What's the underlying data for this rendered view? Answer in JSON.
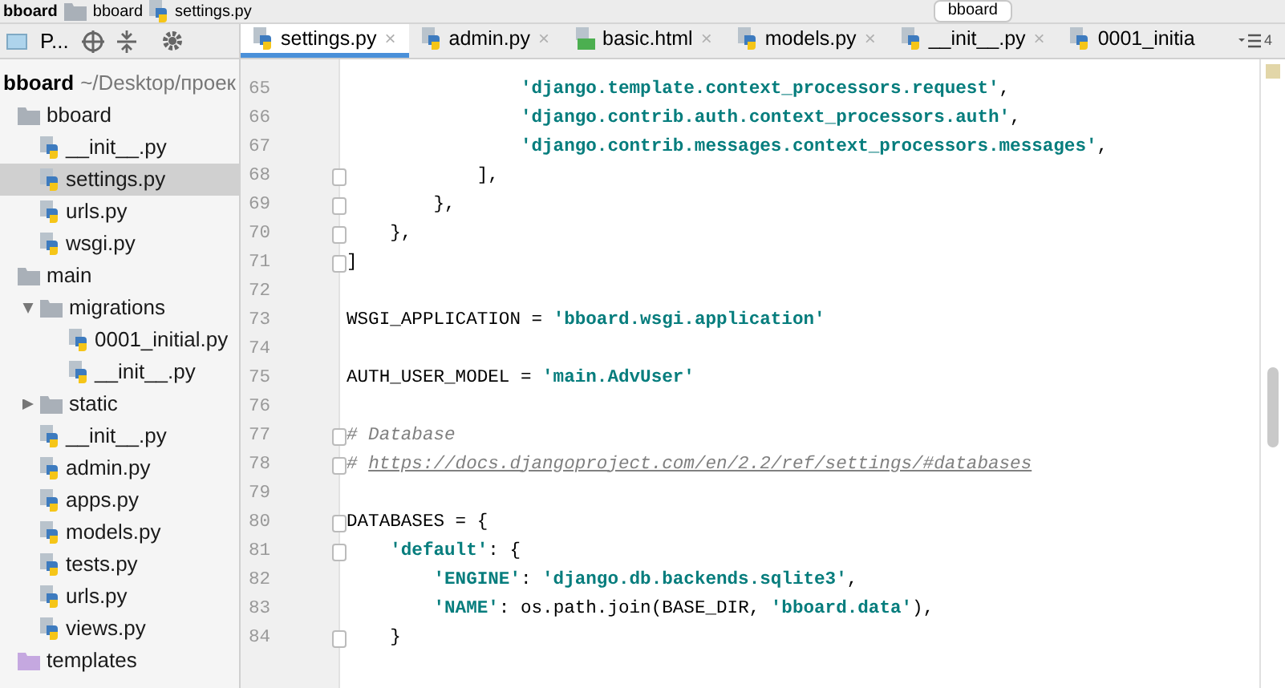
{
  "nav_bar": {
    "crumbs": [
      {
        "label": "bboard",
        "kind": "project"
      },
      {
        "label": "bboard",
        "kind": "folder"
      },
      {
        "label": "settings.py",
        "kind": "python"
      }
    ],
    "run_config": "bboard"
  },
  "project_panel": {
    "selector": "P..."
  },
  "tabs": [
    {
      "label": "settings.py",
      "kind": "python",
      "selected": true,
      "close": "×"
    },
    {
      "label": "admin.py",
      "kind": "python",
      "selected": false,
      "close": "×"
    },
    {
      "label": "basic.html",
      "kind": "html",
      "selected": false,
      "close": "×"
    },
    {
      "label": "models.py",
      "kind": "python",
      "selected": false,
      "close": "×"
    },
    {
      "label": "__init__.py",
      "kind": "python",
      "selected": false,
      "close": "×"
    },
    {
      "label": "0001_initia",
      "kind": "python",
      "selected": false
    }
  ],
  "tabs_overflow": "4",
  "tree": {
    "root": {
      "label": "bboard",
      "path": "~/Desktop/проек"
    },
    "children": [
      {
        "label": "bboard",
        "kind": "folder",
        "children": [
          {
            "label": "__init__.py",
            "kind": "python",
            "selected": false
          },
          {
            "label": "settings.py",
            "kind": "python",
            "selected": true
          },
          {
            "label": "urls.py",
            "kind": "python",
            "selected": false
          },
          {
            "label": "wsgi.py",
            "kind": "python",
            "selected": false
          }
        ]
      },
      {
        "label": "main",
        "kind": "folder",
        "children": [
          {
            "label": "migrations",
            "kind": "folder",
            "expanded": true,
            "children": [
              {
                "label": "0001_initial.py",
                "kind": "python",
                "selected": false
              },
              {
                "label": "__init__.py",
                "kind": "python",
                "selected": false
              }
            ]
          },
          {
            "label": "static",
            "kind": "folder",
            "expanded": false
          },
          {
            "label": "__init__.py",
            "kind": "python",
            "selected": false
          },
          {
            "label": "admin.py",
            "kind": "python",
            "selected": false
          },
          {
            "label": "apps.py",
            "kind": "python",
            "selected": false
          },
          {
            "label": "models.py",
            "kind": "python",
            "selected": false
          },
          {
            "label": "tests.py",
            "kind": "python",
            "selected": false
          },
          {
            "label": "urls.py",
            "kind": "python",
            "selected": false
          },
          {
            "label": "views.py",
            "kind": "python",
            "selected": false
          }
        ]
      },
      {
        "label": "templates",
        "kind": "templates"
      }
    ]
  },
  "editor": {
    "lines": [
      {
        "number": "65",
        "fold": false,
        "tokens": [
          {
            "kind": "string",
            "text": "                'django.template.context_processors.request'"
          },
          {
            "kind": "plain",
            "text": ","
          }
        ]
      },
      {
        "number": "66",
        "fold": false,
        "tokens": [
          {
            "kind": "string",
            "text": "                'django.contrib.auth.context_processors.auth'"
          },
          {
            "kind": "plain",
            "text": ","
          }
        ]
      },
      {
        "number": "67",
        "fold": false,
        "tokens": [
          {
            "kind": "string",
            "text": "                'django.contrib.messages.context_processors.messages'"
          },
          {
            "kind": "plain",
            "text": ","
          }
        ]
      },
      {
        "number": "68",
        "fold": true,
        "tokens": [
          {
            "kind": "plain",
            "text": "            ],"
          }
        ]
      },
      {
        "number": "69",
        "fold": true,
        "tokens": [
          {
            "kind": "plain",
            "text": "        },"
          }
        ]
      },
      {
        "number": "70",
        "fold": true,
        "tokens": [
          {
            "kind": "plain",
            "text": "    },"
          }
        ]
      },
      {
        "number": "71",
        "fold": true,
        "tokens": [
          {
            "kind": "plain",
            "text": "]"
          }
        ]
      },
      {
        "number": "72",
        "fold": false
      },
      {
        "number": "73",
        "fold": false,
        "tokens": [
          {
            "kind": "plain",
            "text": "WSGI_APPLICATION = "
          },
          {
            "kind": "string",
            "text": "'bboard.wsgi.application'"
          }
        ]
      },
      {
        "number": "74",
        "fold": false
      },
      {
        "number": "75",
        "fold": false,
        "tokens": [
          {
            "kind": "plain",
            "text": "AUTH_USER_MODEL = "
          },
          {
            "kind": "string",
            "text": "'main.AdvUser'"
          }
        ]
      },
      {
        "number": "76",
        "fold": false
      },
      {
        "number": "77",
        "fold": true,
        "tokens": [
          {
            "kind": "comment",
            "text": "# Database"
          }
        ]
      },
      {
        "number": "78",
        "fold": true,
        "tokens": [
          {
            "kind": "comment",
            "text": "# "
          },
          {
            "kind": "link",
            "text": "https://docs.djangoproject.com/en/2.2/ref/settings/#databases"
          }
        ]
      },
      {
        "number": "79",
        "fold": false
      },
      {
        "number": "80",
        "fold": true,
        "tokens": [
          {
            "kind": "plain",
            "text": "DATABASES = {"
          }
        ]
      },
      {
        "number": "81",
        "fold": true,
        "tokens": [
          {
            "kind": "string",
            "text": "    'default'"
          },
          {
            "kind": "plain",
            "text": ": {"
          }
        ]
      },
      {
        "number": "82",
        "fold": false,
        "tokens": [
          {
            "kind": "string",
            "text": "        'ENGINE'"
          },
          {
            "kind": "plain",
            "text": ": "
          },
          {
            "kind": "string",
            "text": "'django.db.backends.sqlite3'"
          },
          {
            "kind": "plain",
            "text": ","
          }
        ]
      },
      {
        "number": "83",
        "fold": false,
        "tokens": [
          {
            "kind": "string",
            "text": "        'NAME'"
          },
          {
            "kind": "plain",
            "text": ": os.path.join(BASE_DIR, "
          },
          {
            "kind": "string",
            "text": "'bboard.data'"
          },
          {
            "kind": "plain",
            "text": "),"
          }
        ]
      },
      {
        "number": "84",
        "fold": true,
        "tokens": [
          {
            "kind": "plain",
            "text": "    }"
          }
        ]
      }
    ]
  }
}
